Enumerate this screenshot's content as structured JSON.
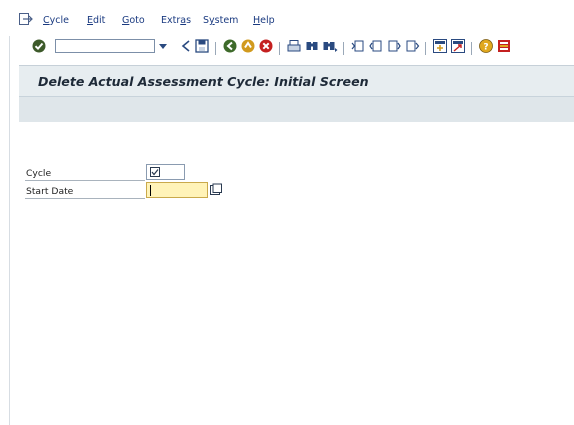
{
  "menubar": {
    "items": [
      {
        "pre": "",
        "acc": "C",
        "post": "ycle"
      },
      {
        "pre": "",
        "acc": "E",
        "post": "dit"
      },
      {
        "pre": "",
        "acc": "G",
        "post": "oto"
      },
      {
        "pre": "Extr",
        "acc": "a",
        "post": "s"
      },
      {
        "pre": "S",
        "acc": "y",
        "post": "stem"
      },
      {
        "pre": "",
        "acc": "H",
        "post": "elp"
      }
    ]
  },
  "toolbar": {
    "command_value": "",
    "icons": [
      "enter-icon",
      "back-arrow-icon",
      "save-icon",
      "back-icon",
      "exit-icon",
      "cancel-icon",
      "print-icon",
      "find-icon",
      "find-next-icon",
      "first-page-icon",
      "previous-page-icon",
      "next-page-icon",
      "last-page-icon",
      "create-session-icon",
      "shortcut-icon",
      "help-icon",
      "layout-menu-icon"
    ]
  },
  "screen": {
    "title": "Delete Actual Assessment Cycle: Initial Screen"
  },
  "form": {
    "cycle_label": "Cycle",
    "cycle_value": "",
    "start_date_label": "Start Date",
    "start_date_value": ""
  },
  "colors": {
    "menu_text": "#1a3a80",
    "title_band": "#e7edf0",
    "title_area": "#dfe6ea",
    "focused_field": "#fff3b8"
  }
}
